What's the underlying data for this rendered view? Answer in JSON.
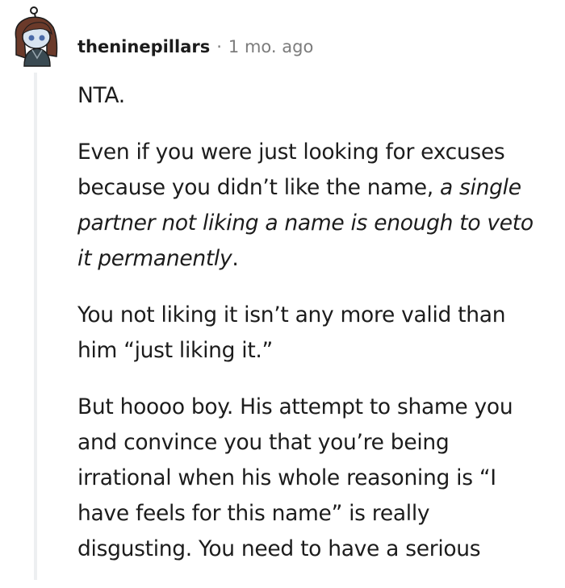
{
  "comment": {
    "username": "theninepillars",
    "separator": "·",
    "timestamp": "1 mo. ago",
    "paragraphs": {
      "p1": "NTA.",
      "p2_text": "Even if you were just looking for excuses because you didn’t like the name, ",
      "p2_italic": "a single partner not liking a name is enough to veto it permanently",
      "p2_end": ".",
      "p3": "You not liking it isn’t any more valid than him “just liking it.”",
      "p4": "But hoooo boy. His attempt to shame you and convince you that you’re being irrational when his whole reasoning is “I have feels for this name” is really disgusting. You need to have a serious"
    }
  },
  "colors": {
    "text": "#1c1c1c",
    "meta": "#7c7c7c",
    "thread_line": "#edeff1",
    "avatar_hair": "#6b3a2a",
    "avatar_skin": "#d8e4f0",
    "avatar_shirt": "#3a4a52"
  },
  "icons": {
    "avatar": "snoo-avatar-icon"
  }
}
